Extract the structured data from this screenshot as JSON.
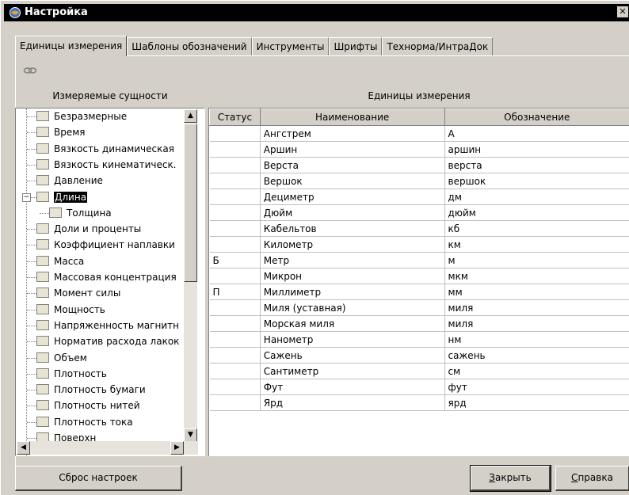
{
  "window": {
    "title": "Настройка",
    "close_glyph": "✕"
  },
  "tabs": [
    {
      "label": "Единицы измерения"
    },
    {
      "label": "Шаблоны обозначений"
    },
    {
      "label": "Инструменты"
    },
    {
      "label": "Шрифты"
    },
    {
      "label": "Технорма/ИнтраДок"
    }
  ],
  "toolbar": {
    "link_icon": "link-icon"
  },
  "left_panel": {
    "header": "Измеряемые сущности",
    "items": [
      {
        "label": "Безразмерные"
      },
      {
        "label": "Время"
      },
      {
        "label": "Вязкость динамическая"
      },
      {
        "label": "Вязкость кинематическ."
      },
      {
        "label": "Давление"
      },
      {
        "label": "Длина",
        "expanded": true,
        "selected": true
      },
      {
        "label": "Толщина",
        "child": true
      },
      {
        "label": "Доли и проценты"
      },
      {
        "label": "Коэффициент наплавки"
      },
      {
        "label": "Масса"
      },
      {
        "label": "Массовая концентрация"
      },
      {
        "label": "Момент силы"
      },
      {
        "label": "Мощность"
      },
      {
        "label": "Напряженность магнитн"
      },
      {
        "label": "Норматив расхода лакок"
      },
      {
        "label": "Объем"
      },
      {
        "label": "Плотность"
      },
      {
        "label": "Плотность бумаги"
      },
      {
        "label": "Плотность нитей"
      },
      {
        "label": "Плотность тока"
      },
      {
        "label": "Поверхн"
      }
    ]
  },
  "right_panel": {
    "header": "Единицы измерения",
    "columns": [
      "Статус",
      "Наименование",
      "Обозначение"
    ],
    "rows": [
      {
        "status": "",
        "name": "Ангстрем",
        "symbol": "А"
      },
      {
        "status": "",
        "name": "Аршин",
        "symbol": "аршин"
      },
      {
        "status": "",
        "name": "Верста",
        "symbol": "верста"
      },
      {
        "status": "",
        "name": "Вершок",
        "symbol": "вершок"
      },
      {
        "status": "",
        "name": "Дециметр",
        "symbol": "дм"
      },
      {
        "status": "",
        "name": "Дюйм",
        "symbol": "дюйм"
      },
      {
        "status": "",
        "name": "Кабельтов",
        "symbol": "кб"
      },
      {
        "status": "",
        "name": "Километр",
        "symbol": "км"
      },
      {
        "status": "Б",
        "name": "Метр",
        "symbol": "м"
      },
      {
        "status": "",
        "name": "Микрон",
        "symbol": "мкм"
      },
      {
        "status": "П",
        "name": "Миллиметр",
        "symbol": "мм"
      },
      {
        "status": "",
        "name": "Миля (уставная)",
        "symbol": "миля"
      },
      {
        "status": "",
        "name": "Морская миля",
        "symbol": "миля"
      },
      {
        "status": "",
        "name": "Нанометр",
        "symbol": "нм"
      },
      {
        "status": "",
        "name": "Сажень",
        "symbol": "сажень"
      },
      {
        "status": "",
        "name": "Сантиметр",
        "symbol": "см"
      },
      {
        "status": "",
        "name": "Фут",
        "symbol": "фут"
      },
      {
        "status": "",
        "name": "Ярд",
        "symbol": "ярд"
      }
    ]
  },
  "buttons": {
    "reset": "Сброс настроек",
    "close_first": "З",
    "close_rest": "акрыть",
    "help_first": "С",
    "help_rest": "правка"
  }
}
